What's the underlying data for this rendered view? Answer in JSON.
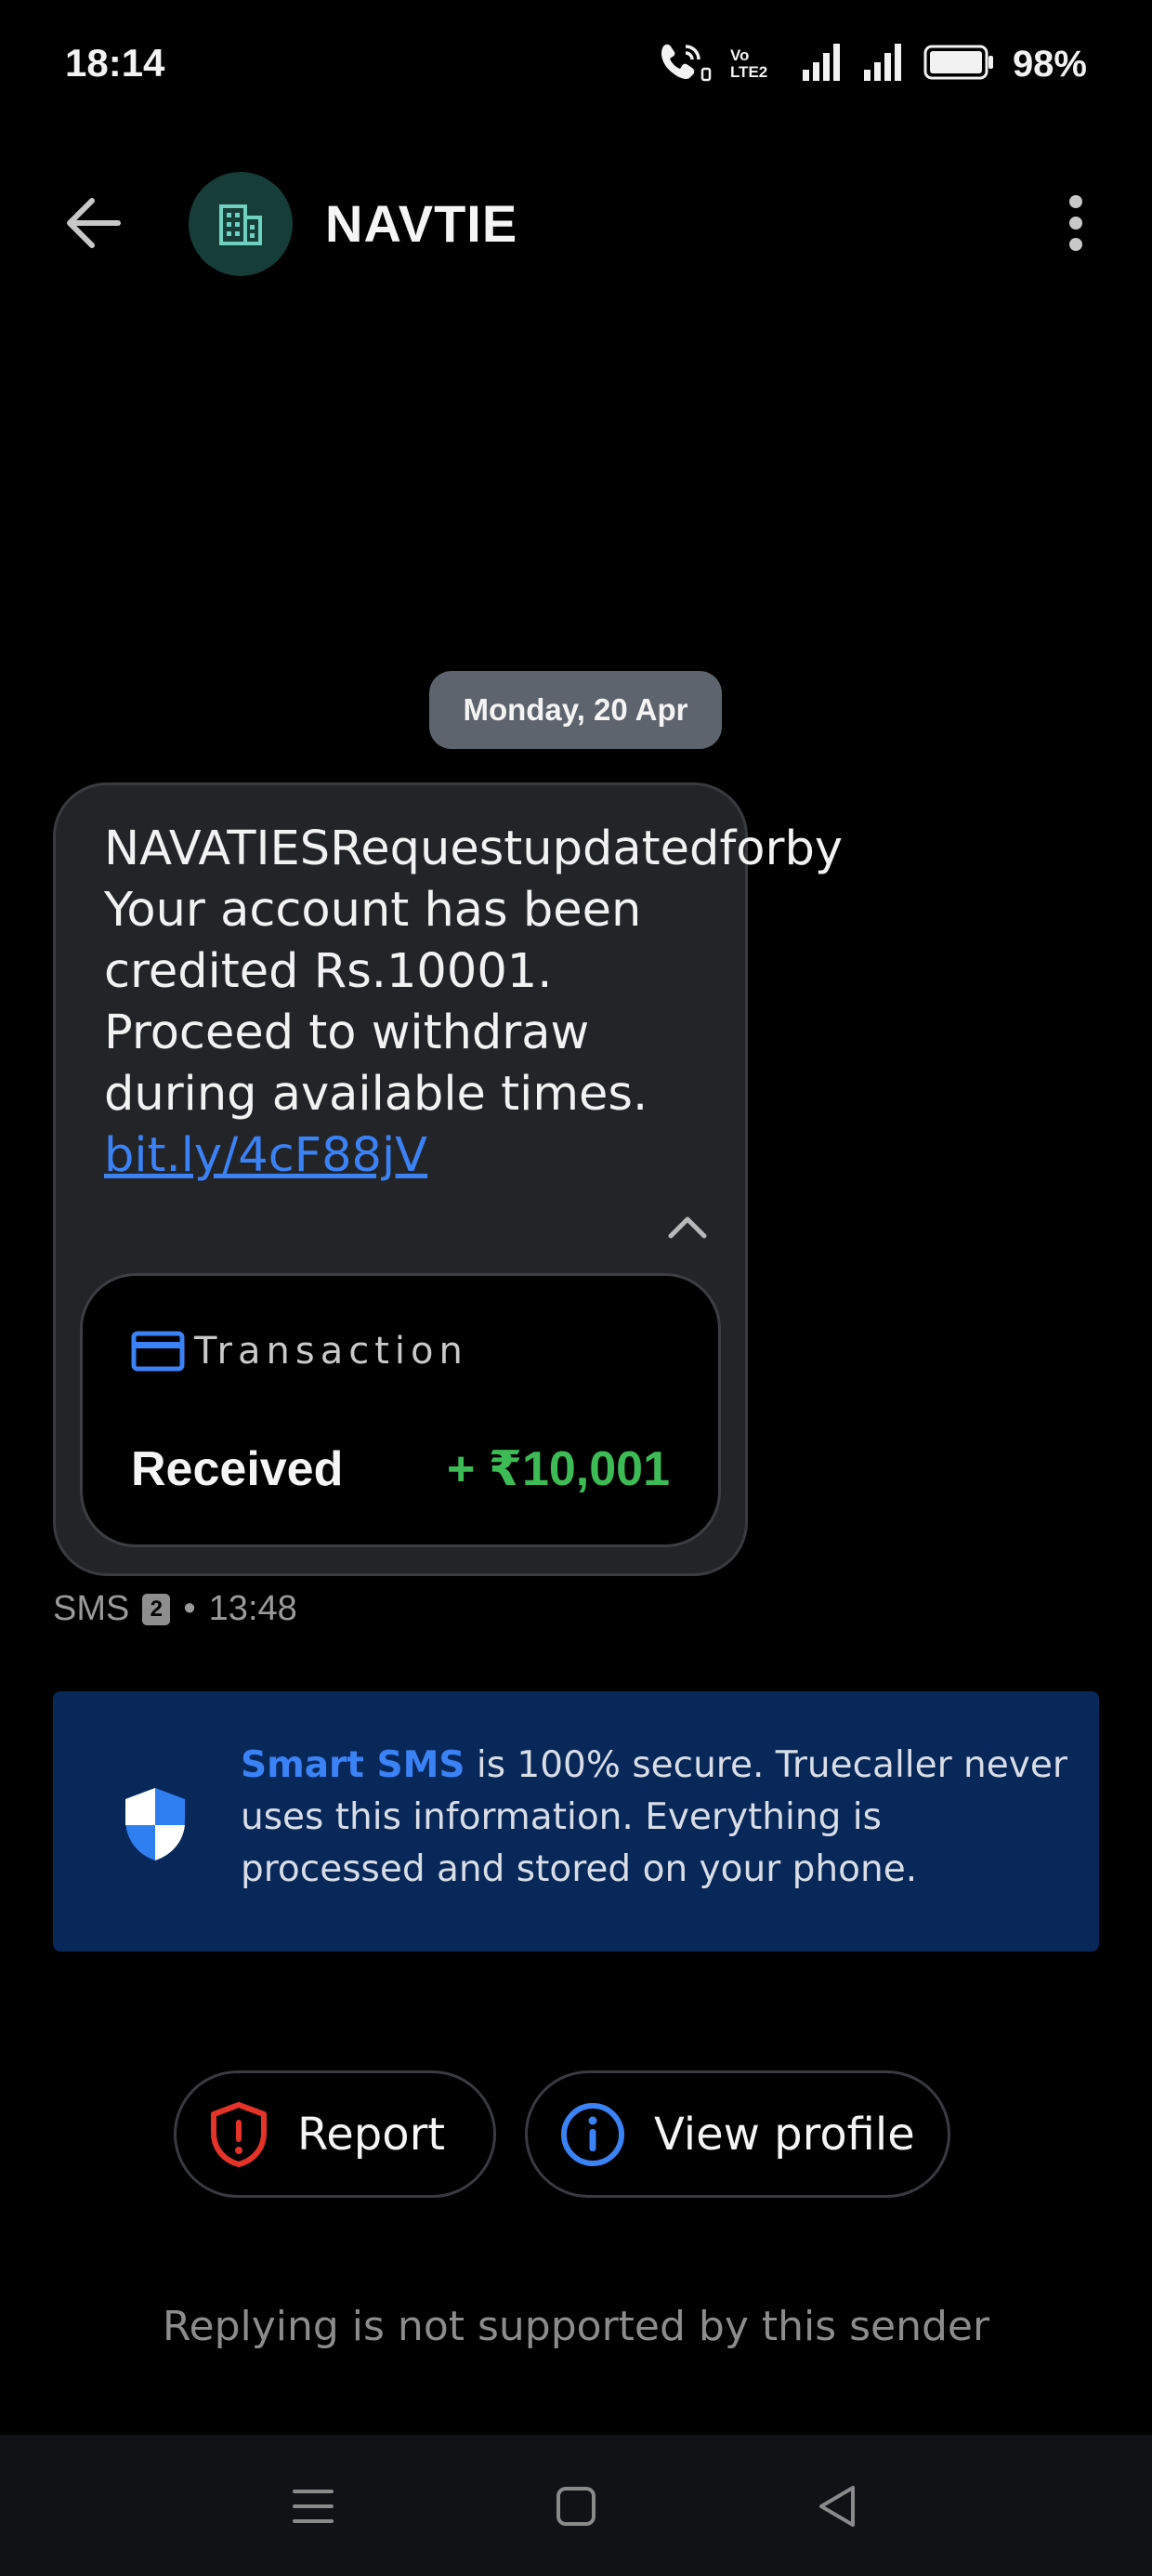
{
  "status_bar": {
    "time": "18:14",
    "volte_label_top": "Vo",
    "volte_label_bottom": "LTE2",
    "battery_percent": "98%",
    "battery_level": 0.98
  },
  "header": {
    "sender_name": "NAVTIE",
    "avatar_icon": "building-icon",
    "accent_color": "#173d38"
  },
  "thread": {
    "date_chip": "Monday, 20 Apr",
    "message": {
      "text": "NAVATIESRequestupdatedforby Your account has been credited Rs.10001. Proceed to withdraw during available times. ",
      "link": "bit.ly/4cF88jV"
    },
    "transaction": {
      "title": "Transaction",
      "label": "Received",
      "amount": "+ ₹10,001",
      "amount_color": "#3dbb55"
    },
    "meta": {
      "channel": "SMS",
      "sim": "2",
      "separator": "•",
      "time": "13:48"
    }
  },
  "info_banner": {
    "accent_text": "Smart SMS",
    "body_text": " is 100% secure. Truecaller never uses this information. Everything is processed and stored on your phone."
  },
  "actions": {
    "report_label": "Report",
    "view_profile_label": "View profile"
  },
  "footer_note": "Replying is not supported by this sender"
}
